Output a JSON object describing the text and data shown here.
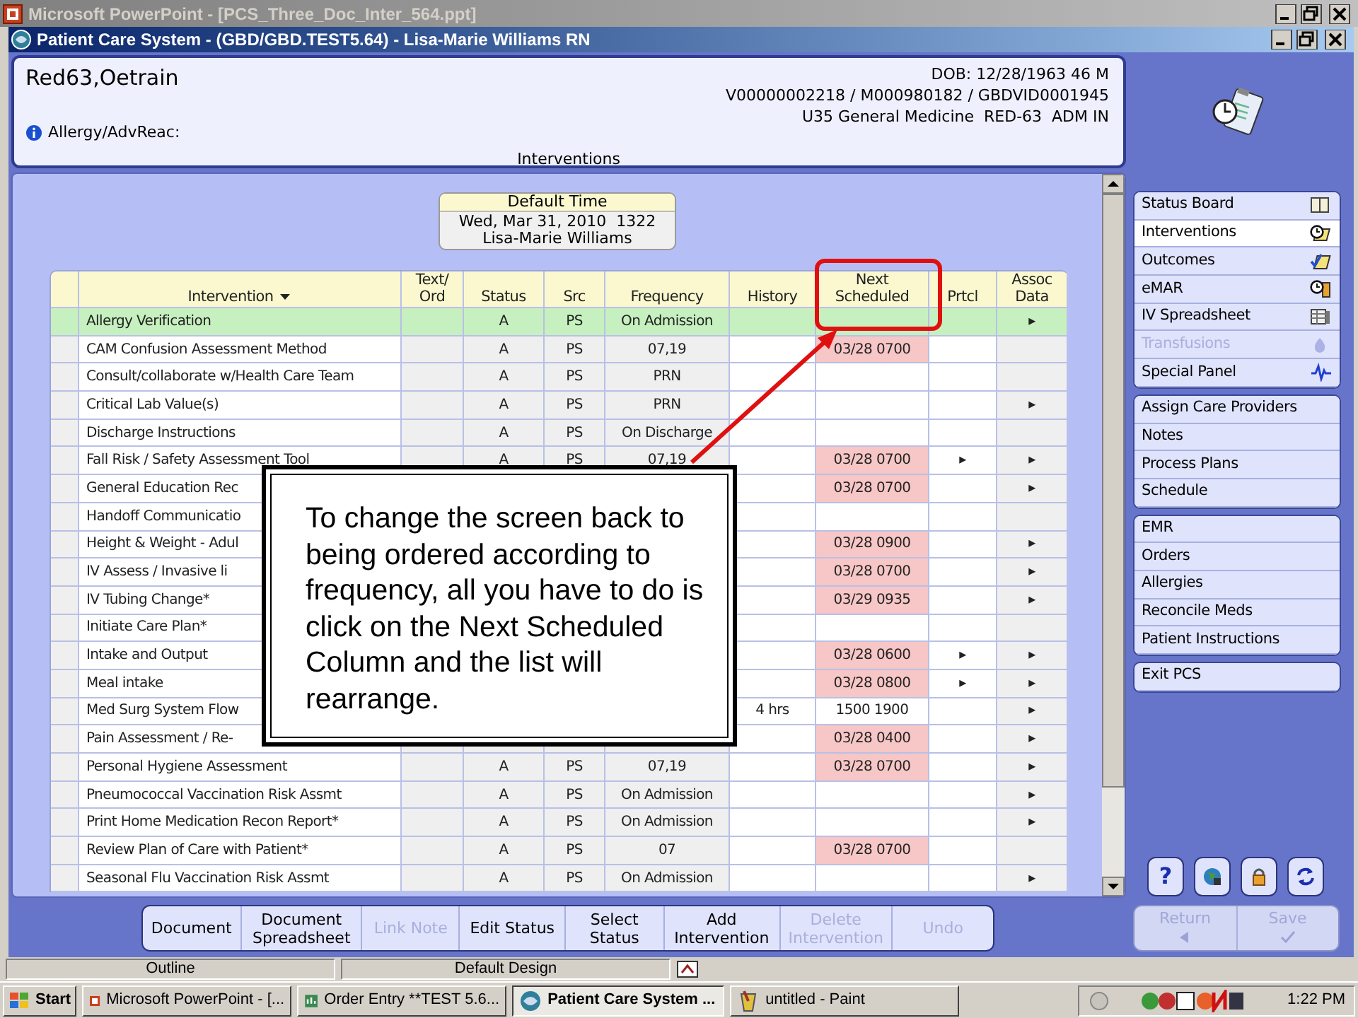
{
  "app_window": {
    "title": "Microsoft PowerPoint - [PCS_Three_Doc_Inter_564.ppt]"
  },
  "window": {
    "title": "Patient Care System - (GBD/GBD.TEST5.64) - Lisa-Marie Williams RN"
  },
  "patient_header": {
    "name": "Red63,Oetrain",
    "dob": "DOB: 12/28/1963 46 M",
    "ids": "V00000002218 / M000980182 / GBDVID0001945",
    "location": "U35 General Medicine  RED-63  ADM IN",
    "allergy_label": "Allergy/AdvReac:",
    "section_title": "Interventions"
  },
  "default_time": {
    "label": "Default Time",
    "date": "Wed, Mar 31, 2010  1322",
    "user": "Lisa-Marie Williams"
  },
  "table": {
    "columns": [
      {
        "label": "Intervention",
        "sorted": true
      },
      {
        "label": "Text/ Ord",
        "sorted": false
      },
      {
        "label": "Status",
        "sorted": false
      },
      {
        "label": "Src",
        "sorted": false
      },
      {
        "label": "Frequency",
        "sorted": false
      },
      {
        "label": "History",
        "sorted": false
      },
      {
        "label": "Next Scheduled",
        "sorted": false
      },
      {
        "label": "Prtcl",
        "sorted": false
      },
      {
        "label": "Assoc Data",
        "sorted": false
      }
    ],
    "rows": [
      {
        "intervention": "Allergy Verification",
        "status": "A",
        "src": "PS",
        "frequency": "On Admission",
        "assoc_data": "▸",
        "selected": true,
        "overdue": false
      },
      {
        "intervention": "CAM Confusion Assessment Method",
        "status": "A",
        "src": "PS",
        "frequency": "07,19",
        "next_scheduled": "03/28 0700",
        "selected": false,
        "overdue": true
      },
      {
        "intervention": "Consult/collaborate w/Health Care Team",
        "status": "A",
        "src": "PS",
        "frequency": "PRN",
        "selected": false,
        "overdue": false
      },
      {
        "intervention": "Critical Lab Value(s)",
        "status": "A",
        "src": "PS",
        "frequency": "PRN",
        "assoc_data": "▸",
        "selected": false,
        "overdue": false
      },
      {
        "intervention": "Discharge Instructions",
        "status": "A",
        "src": "PS",
        "frequency": "On Discharge",
        "selected": false,
        "overdue": false
      },
      {
        "intervention": "Fall Risk / Safety Assessment Tool",
        "status": "A",
        "src": "PS",
        "frequency": "07,19",
        "next_scheduled": "03/28 0700",
        "prtcl": "▸",
        "assoc_data": "▸",
        "selected": false,
        "overdue": true
      },
      {
        "intervention": "General Education Rec",
        "next_scheduled": "03/28 0700",
        "assoc_data": "▸",
        "selected": false,
        "overdue": true
      },
      {
        "intervention": "Handoff Communicatio",
        "selected": false,
        "overdue": false
      },
      {
        "intervention": "Height & Weight - Adul",
        "next_scheduled": "03/28 0900",
        "assoc_data": "▸",
        "selected": false,
        "overdue": true
      },
      {
        "intervention": "IV Assess / Invasive li",
        "next_scheduled": "03/28 0700",
        "assoc_data": "▸",
        "selected": false,
        "overdue": true
      },
      {
        "intervention": "IV Tubing Change*",
        "next_scheduled": "03/29 0935",
        "assoc_data": "▸",
        "selected": false,
        "overdue": true
      },
      {
        "intervention": "Initiate Care Plan*",
        "selected": false,
        "overdue": false
      },
      {
        "intervention": "Intake and Output",
        "next_scheduled": "03/28 0600",
        "prtcl": "▸",
        "assoc_data": "▸",
        "selected": false,
        "overdue": true
      },
      {
        "intervention": "Meal intake",
        "next_scheduled": "03/28 0800",
        "prtcl": "▸",
        "assoc_data": "▸",
        "selected": false,
        "overdue": true
      },
      {
        "intervention": "Med Surg System Flow",
        "history": "4 hrs",
        "next_scheduled": "1500 1900",
        "assoc_data": "▸",
        "selected": false,
        "overdue": false
      },
      {
        "intervention": "Pain Assessment / Re-",
        "next_scheduled": "03/28 0400",
        "assoc_data": "▸",
        "selected": false,
        "overdue": true
      },
      {
        "intervention": "Personal Hygiene Assessment",
        "status": "A",
        "src": "PS",
        "frequency": "07,19",
        "next_scheduled": "03/28 0700",
        "assoc_data": "▸",
        "selected": false,
        "overdue": true
      },
      {
        "intervention": "Pneumococcal Vaccination Risk Assmt",
        "status": "A",
        "src": "PS",
        "frequency": "On Admission",
        "assoc_data": "▸",
        "selected": false,
        "overdue": false
      },
      {
        "intervention": "Print Home Medication Recon Report*",
        "status": "A",
        "src": "PS",
        "frequency": "On Admission",
        "assoc_data": "▸",
        "selected": false,
        "overdue": false
      },
      {
        "intervention": "Review Plan of Care with Patient*",
        "status": "A",
        "src": "PS",
        "frequency": "07",
        "next_scheduled": "03/28 0700",
        "selected": false,
        "overdue": true
      },
      {
        "intervention": "Seasonal Flu Vaccination Risk Assmt",
        "status": "A",
        "src": "PS",
        "frequency": "On Admission",
        "assoc_data": "▸",
        "selected": false,
        "overdue": false
      }
    ]
  },
  "callout": {
    "text": "To change the screen back to being ordered according to frequency, all you have to do is click on the Next Scheduled Column and the list will rearrange."
  },
  "sidebar": {
    "groups": [
      {
        "items": [
          {
            "label": "Status Board",
            "selected": false,
            "disabled": false
          },
          {
            "label": "Interventions",
            "selected": true,
            "disabled": false
          },
          {
            "label": "Outcomes",
            "selected": false,
            "disabled": false
          },
          {
            "label": "eMAR",
            "selected": false,
            "disabled": false
          },
          {
            "label": "IV Spreadsheet",
            "selected": false,
            "disabled": false
          },
          {
            "label": "Transfusions",
            "selected": false,
            "disabled": true
          },
          {
            "label": "Special Panel",
            "selected": false,
            "disabled": false
          }
        ]
      },
      {
        "items": [
          {
            "label": "Assign Care Providers",
            "selected": false,
            "disabled": false
          },
          {
            "label": "Notes",
            "selected": false,
            "disabled": false
          },
          {
            "label": "Process Plans",
            "selected": false,
            "disabled": false
          },
          {
            "label": "Schedule",
            "selected": false,
            "disabled": false
          }
        ]
      },
      {
        "items": [
          {
            "label": "EMR",
            "selected": false,
            "disabled": false
          },
          {
            "label": "Orders",
            "selected": false,
            "disabled": false
          },
          {
            "label": "Allergies",
            "selected": false,
            "disabled": false
          },
          {
            "label": "Reconcile Meds",
            "selected": false,
            "disabled": false
          },
          {
            "label": "Patient Instructions",
            "selected": false,
            "disabled": false
          }
        ]
      },
      {
        "items": [
          {
            "label": "Exit PCS",
            "selected": false,
            "disabled": false
          }
        ]
      }
    ]
  },
  "tools": {
    "help_label": "?"
  },
  "toolbar": {
    "buttons": [
      {
        "label": "Document",
        "disabled": false
      },
      {
        "label": "Document Spreadsheet",
        "disabled": false
      },
      {
        "label": "Link Note",
        "disabled": true
      },
      {
        "label": "Edit Status",
        "disabled": false
      },
      {
        "label": "Select Status",
        "disabled": false
      },
      {
        "label": "Add Intervention",
        "disabled": false
      },
      {
        "label": "Delete Intervention",
        "disabled": true
      },
      {
        "label": "Undo",
        "disabled": true
      }
    ]
  },
  "footer_buttons": [
    {
      "label": "Return",
      "disabled": true
    },
    {
      "label": "Save",
      "disabled": true
    }
  ],
  "ppt_status_bar": {
    "panes": [
      "Outline",
      "Default Design"
    ]
  },
  "taskbar": {
    "start": "Start",
    "tasks": [
      {
        "label": "Microsoft PowerPoint - [...",
        "selected": false
      },
      {
        "label": "Order Entry **TEST 5.6...",
        "selected": false
      },
      {
        "label": "Patient Care System ...",
        "selected": true
      },
      {
        "label": "untitled - Paint",
        "selected": false
      }
    ],
    "clock": "1:22 PM"
  }
}
